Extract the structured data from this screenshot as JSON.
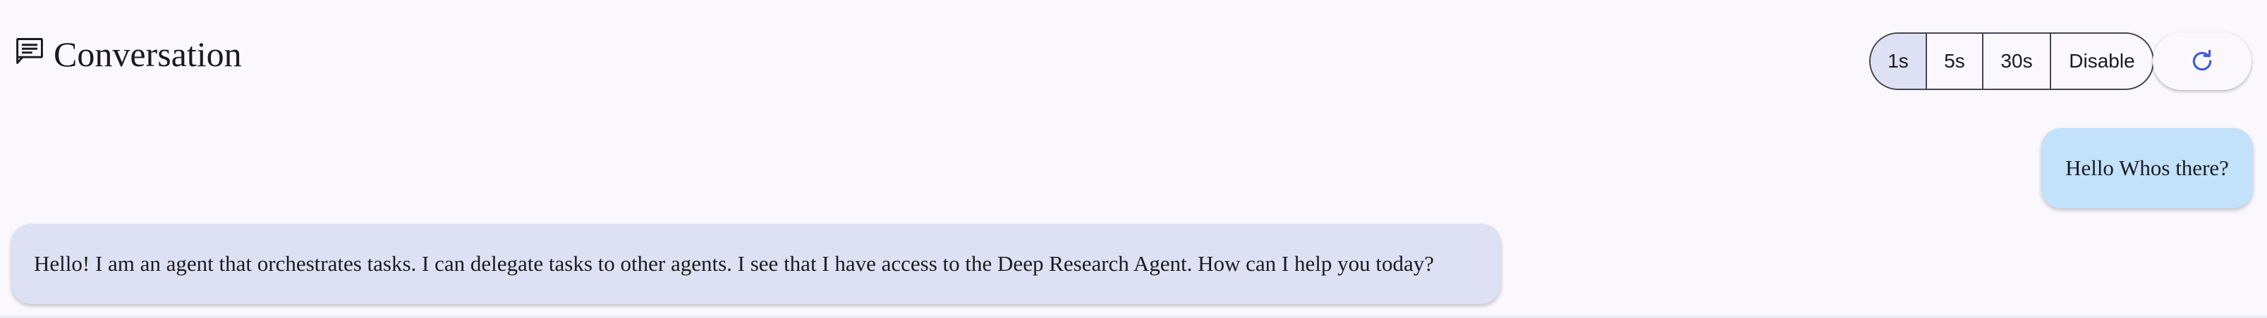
{
  "header": {
    "title": "Conversation",
    "icon": "chat-icon"
  },
  "refresh_controls": {
    "options": [
      "1s",
      "5s",
      "30s",
      "Disable"
    ],
    "selected": "1s",
    "selected_color": "#dee0f3",
    "refresh_icon": "refresh-icon",
    "accent_color": "#3f5bd8"
  },
  "messages": [
    {
      "role": "user",
      "text": "Hello Whos there?",
      "bubble_color": "#c2e1fb"
    },
    {
      "role": "agent",
      "text": "Hello! I am an agent that orchestrates tasks. I can delegate tasks to other agents. I see that I have access to the Deep Research Agent. How can I help you today?",
      "bubble_color": "#dee0f3"
    }
  ]
}
